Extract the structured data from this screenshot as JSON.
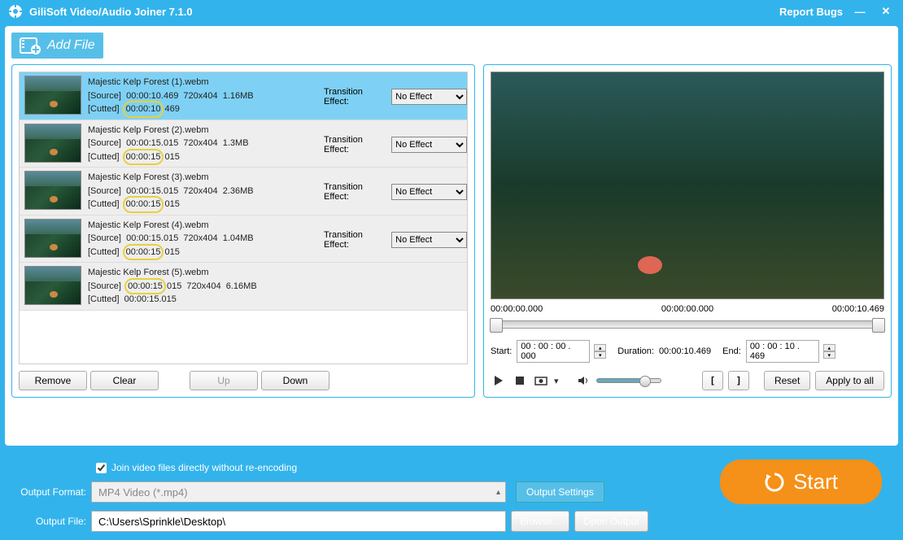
{
  "window": {
    "title": "GiliSoft Video/Audio Joiner 7.1.0",
    "report": "Report Bugs"
  },
  "toolbar": {
    "add_file": "Add File"
  },
  "files": [
    {
      "name": "Majestic Kelp Forest (1).webm",
      "src_time": "00:00:10.469",
      "res": "720x404",
      "size": "1.16MB",
      "cut_a": "00:00:10",
      "cut_b": "469",
      "selected": true,
      "transition_label": "Transition Effect:",
      "transition_value": "No Effect"
    },
    {
      "name": "Majestic Kelp Forest (2).webm",
      "src_time": "00:00:15.015",
      "res": "720x404",
      "size": "1.3MB",
      "cut_a": "00:00:15",
      "cut_b": "015",
      "selected": false,
      "transition_label": "Transition Effect:",
      "transition_value": "No Effect"
    },
    {
      "name": "Majestic Kelp Forest (3).webm",
      "src_time": "00:00:15.015",
      "res": "720x404",
      "size": "2.36MB",
      "cut_a": "00:00:15",
      "cut_b": "015",
      "selected": false,
      "transition_label": "Transition Effect:",
      "transition_value": "No Effect"
    },
    {
      "name": "Majestic Kelp Forest (4).webm",
      "src_time": "00:00:15.015",
      "res": "720x404",
      "size": "1.04MB",
      "cut_a": "00:00:15",
      "cut_b": "015",
      "selected": false,
      "transition_label": "Transition Effect:",
      "transition_value": "No Effect"
    },
    {
      "name": "Majestic Kelp Forest (5).webm",
      "src_time": "00:00:15",
      "res": "720x404",
      "size": "6.16MB",
      "cut_a": "00:00:15.015",
      "cut_b": "",
      "selected": false,
      "highlight_src": true
    }
  ],
  "labels": {
    "source": "[Source]",
    "cutted": "[Cutted]"
  },
  "buttons": {
    "remove": "Remove",
    "clear": "Clear",
    "up": "Up",
    "down": "Down",
    "reset": "Reset",
    "apply_all": "Apply to all",
    "browse": "Browse...",
    "open_output": "Open Output",
    "output_settings": "Output Settings",
    "start": "Start"
  },
  "preview": {
    "time_a": "00:00:00.000",
    "time_b": "00:00:00.000",
    "time_c": "00:00:10.469",
    "start_label": "Start:",
    "start_value": "00 : 00 : 00 . 000",
    "duration_label": "Duration:",
    "duration_value": "00:00:10.469",
    "end_label": "End:",
    "end_value": "00 : 00 : 10 . 469"
  },
  "bottom": {
    "checkbox": "Join video files directly without re-encoding",
    "format_label": "Output Format:",
    "format_value": "MP4 Video (*.mp4)",
    "file_label": "Output File:",
    "file_value": "C:\\Users\\Sprinkle\\Desktop\\"
  }
}
